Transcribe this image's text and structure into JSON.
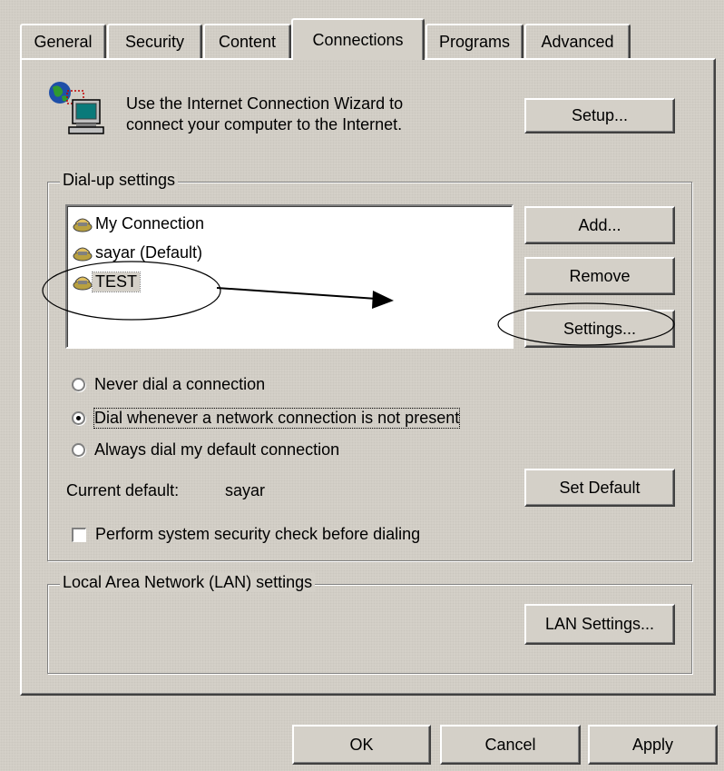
{
  "tabs": [
    {
      "label": "General",
      "active": false
    },
    {
      "label": "Security",
      "active": false
    },
    {
      "label": "Content",
      "active": false
    },
    {
      "label": "Connections",
      "active": true
    },
    {
      "label": "Programs",
      "active": false
    },
    {
      "label": "Advanced",
      "active": false
    }
  ],
  "wizard": {
    "text_line1": "Use the Internet Connection Wizard to",
    "text_line2": "connect your computer to the Internet.",
    "setup_label": "Setup...",
    "icon": "network-computer-icon"
  },
  "dialup": {
    "group_title": "Dial-up settings",
    "connections": [
      {
        "label": "My Connection",
        "icon": "dialup-connection-icon",
        "selected": false
      },
      {
        "label": "sayar (Default)",
        "icon": "dialup-connection-icon",
        "selected": false
      },
      {
        "label": "TEST",
        "icon": "dialup-connection-icon",
        "selected": true
      }
    ],
    "add_label": "Add...",
    "remove_label": "Remove",
    "settings_label": "Settings...",
    "radio_options": [
      {
        "label": "Never dial a connection",
        "checked": false
      },
      {
        "label": "Dial whenever a network connection is not present",
        "checked": true
      },
      {
        "label": "Always dial my default connection",
        "checked": false
      }
    ],
    "current_default_label": "Current default:",
    "current_default_value": "sayar",
    "set_default_label": "Set Default",
    "security_check_label": "Perform system security check before dialing",
    "security_check_checked": false
  },
  "lan": {
    "group_title": "Local Area Network (LAN) settings",
    "lan_settings_label": "LAN Settings..."
  },
  "footer": {
    "ok_label": "OK",
    "cancel_label": "Cancel",
    "apply_label": "Apply"
  },
  "colors": {
    "face": "#d4d0c8",
    "highlight": "#ffffff",
    "shadow": "#808080",
    "dark_shadow": "#404040"
  }
}
